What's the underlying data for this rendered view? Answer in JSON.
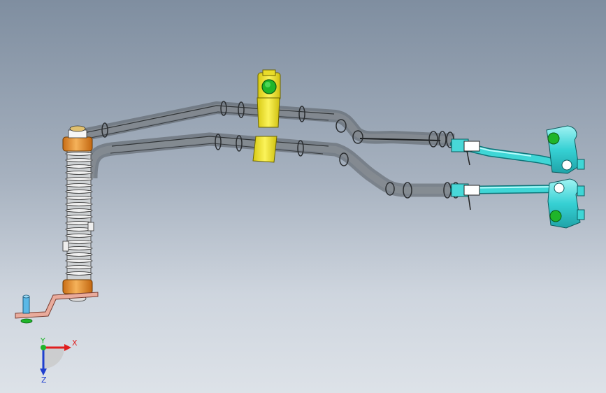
{
  "viewport": {
    "background_top": "#7f8ea0",
    "background_bottom": "#dde2e8"
  },
  "model": {
    "name": "",
    "components": [
      {
        "name": "upper-hose",
        "color": "#6f7478"
      },
      {
        "name": "lower-hose",
        "color": "#6f7478"
      },
      {
        "name": "hose-clamp-bracket",
        "color": "#f0e62a"
      },
      {
        "name": "clamp-bolt",
        "color": "#1fb52a"
      },
      {
        "name": "insulator-spring-stack",
        "color": "#d8d8d8"
      },
      {
        "name": "orange-bushing",
        "color": "#e69530"
      },
      {
        "name": "mounting-bracket",
        "color": "#e8a899"
      },
      {
        "name": "locating-pin",
        "color": "#5bb8e6"
      },
      {
        "name": "metal-tube",
        "color": "#3fd6d6"
      },
      {
        "name": "flange-block",
        "color": "#3fd6d6"
      },
      {
        "name": "flange-bolt",
        "color": "#1fb52a"
      },
      {
        "name": "spring-clip",
        "color": "#f2f2f2"
      }
    ]
  },
  "triad": {
    "x_label": "X",
    "y_label": "Y",
    "z_label": "Z",
    "x_color": "#e01e1e",
    "y_color": "#1fb52a",
    "z_color": "#1f3fcf"
  }
}
